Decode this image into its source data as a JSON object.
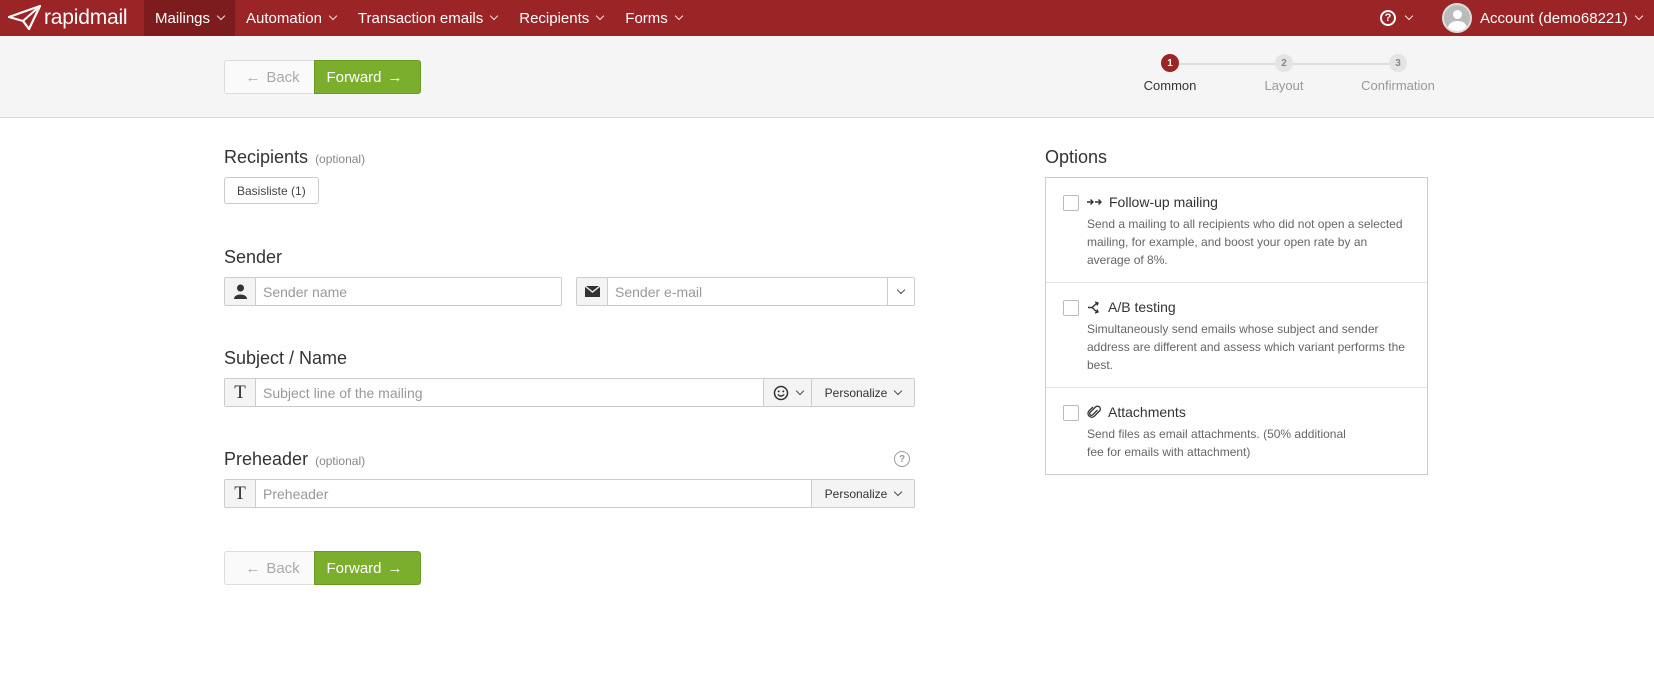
{
  "brand": {
    "name": "rapidmail"
  },
  "nav": {
    "items": [
      {
        "label": "Mailings"
      },
      {
        "label": "Automation"
      },
      {
        "label": "Transaction emails"
      },
      {
        "label": "Recipients"
      },
      {
        "label": "Forms"
      }
    ],
    "account_label": "Account (demo68221)",
    "help_glyph": "?"
  },
  "toolbar": {
    "back_label": "Back",
    "forward_label": "Forward"
  },
  "steps": [
    {
      "num": "1",
      "label": "Common"
    },
    {
      "num": "2",
      "label": "Layout"
    },
    {
      "num": "3",
      "label": "Confirmation"
    }
  ],
  "recipients": {
    "title": "Recipients",
    "optional": "(optional)",
    "list_button": "Basisliste (1)"
  },
  "sender": {
    "title": "Sender",
    "name_placeholder": "Sender name",
    "email_placeholder": "Sender e-mail"
  },
  "subject": {
    "title": "Subject / Name",
    "placeholder": "Subject line of the mailing",
    "personalize_label": "Personalize",
    "addon_glyph": "T"
  },
  "preheader": {
    "title": "Preheader",
    "optional": "(optional)",
    "placeholder": "Preheader",
    "personalize_label": "Personalize",
    "addon_glyph": "T",
    "help_glyph": "?"
  },
  "options": {
    "title": "Options",
    "items": [
      {
        "title": "Follow-up mailing",
        "desc": "Send a mailing to all recipients who did not open a selected mailing, for example, and boost your open rate by an average of 8%."
      },
      {
        "title": "A/B testing",
        "desc": "Simultaneously send emails whose subject and sender address are different and assess which variant performs the best."
      },
      {
        "title": "Attachments",
        "desc": "Send files as email attachments. (50% additional fee for emails with attachment)"
      }
    ]
  },
  "colors": {
    "nav_bg": "#9a2426",
    "primary_green": "#7cae2d",
    "active_step": "#9a2426"
  }
}
